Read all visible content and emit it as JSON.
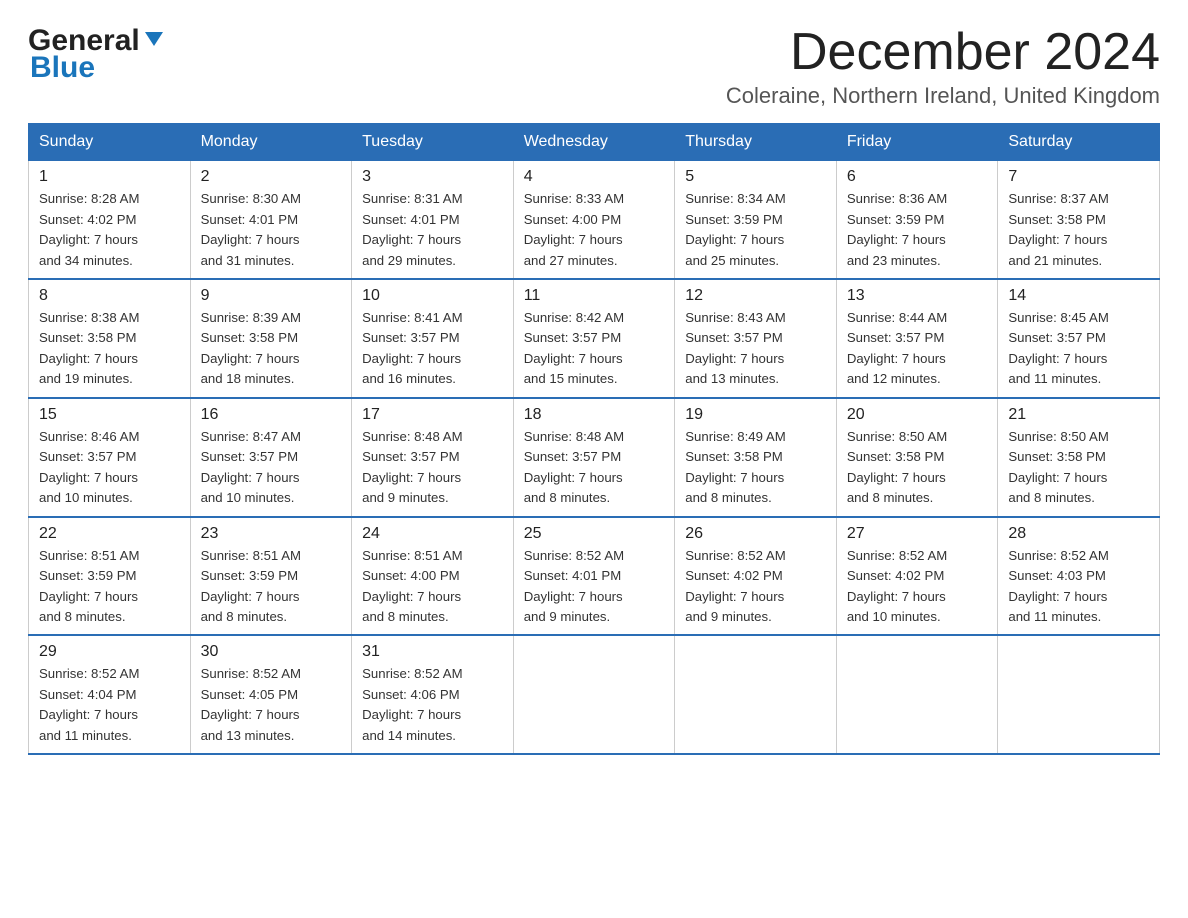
{
  "logo": {
    "general": "General",
    "blue": "Blue"
  },
  "header": {
    "title": "December 2024",
    "subtitle": "Coleraine, Northern Ireland, United Kingdom"
  },
  "days_of_week": [
    "Sunday",
    "Monday",
    "Tuesday",
    "Wednesday",
    "Thursday",
    "Friday",
    "Saturday"
  ],
  "weeks": [
    [
      {
        "day": "1",
        "sunrise": "8:28 AM",
        "sunset": "4:02 PM",
        "daylight": "7 hours and 34 minutes."
      },
      {
        "day": "2",
        "sunrise": "8:30 AM",
        "sunset": "4:01 PM",
        "daylight": "7 hours and 31 minutes."
      },
      {
        "day": "3",
        "sunrise": "8:31 AM",
        "sunset": "4:01 PM",
        "daylight": "7 hours and 29 minutes."
      },
      {
        "day": "4",
        "sunrise": "8:33 AM",
        "sunset": "4:00 PM",
        "daylight": "7 hours and 27 minutes."
      },
      {
        "day": "5",
        "sunrise": "8:34 AM",
        "sunset": "3:59 PM",
        "daylight": "7 hours and 25 minutes."
      },
      {
        "day": "6",
        "sunrise": "8:36 AM",
        "sunset": "3:59 PM",
        "daylight": "7 hours and 23 minutes."
      },
      {
        "day": "7",
        "sunrise": "8:37 AM",
        "sunset": "3:58 PM",
        "daylight": "7 hours and 21 minutes."
      }
    ],
    [
      {
        "day": "8",
        "sunrise": "8:38 AM",
        "sunset": "3:58 PM",
        "daylight": "7 hours and 19 minutes."
      },
      {
        "day": "9",
        "sunrise": "8:39 AM",
        "sunset": "3:58 PM",
        "daylight": "7 hours and 18 minutes."
      },
      {
        "day": "10",
        "sunrise": "8:41 AM",
        "sunset": "3:57 PM",
        "daylight": "7 hours and 16 minutes."
      },
      {
        "day": "11",
        "sunrise": "8:42 AM",
        "sunset": "3:57 PM",
        "daylight": "7 hours and 15 minutes."
      },
      {
        "day": "12",
        "sunrise": "8:43 AM",
        "sunset": "3:57 PM",
        "daylight": "7 hours and 13 minutes."
      },
      {
        "day": "13",
        "sunrise": "8:44 AM",
        "sunset": "3:57 PM",
        "daylight": "7 hours and 12 minutes."
      },
      {
        "day": "14",
        "sunrise": "8:45 AM",
        "sunset": "3:57 PM",
        "daylight": "7 hours and 11 minutes."
      }
    ],
    [
      {
        "day": "15",
        "sunrise": "8:46 AM",
        "sunset": "3:57 PM",
        "daylight": "7 hours and 10 minutes."
      },
      {
        "day": "16",
        "sunrise": "8:47 AM",
        "sunset": "3:57 PM",
        "daylight": "7 hours and 10 minutes."
      },
      {
        "day": "17",
        "sunrise": "8:48 AM",
        "sunset": "3:57 PM",
        "daylight": "7 hours and 9 minutes."
      },
      {
        "day": "18",
        "sunrise": "8:48 AM",
        "sunset": "3:57 PM",
        "daylight": "7 hours and 8 minutes."
      },
      {
        "day": "19",
        "sunrise": "8:49 AM",
        "sunset": "3:58 PM",
        "daylight": "7 hours and 8 minutes."
      },
      {
        "day": "20",
        "sunrise": "8:50 AM",
        "sunset": "3:58 PM",
        "daylight": "7 hours and 8 minutes."
      },
      {
        "day": "21",
        "sunrise": "8:50 AM",
        "sunset": "3:58 PM",
        "daylight": "7 hours and 8 minutes."
      }
    ],
    [
      {
        "day": "22",
        "sunrise": "8:51 AM",
        "sunset": "3:59 PM",
        "daylight": "7 hours and 8 minutes."
      },
      {
        "day": "23",
        "sunrise": "8:51 AM",
        "sunset": "3:59 PM",
        "daylight": "7 hours and 8 minutes."
      },
      {
        "day": "24",
        "sunrise": "8:51 AM",
        "sunset": "4:00 PM",
        "daylight": "7 hours and 8 minutes."
      },
      {
        "day": "25",
        "sunrise": "8:52 AM",
        "sunset": "4:01 PM",
        "daylight": "7 hours and 9 minutes."
      },
      {
        "day": "26",
        "sunrise": "8:52 AM",
        "sunset": "4:02 PM",
        "daylight": "7 hours and 9 minutes."
      },
      {
        "day": "27",
        "sunrise": "8:52 AM",
        "sunset": "4:02 PM",
        "daylight": "7 hours and 10 minutes."
      },
      {
        "day": "28",
        "sunrise": "8:52 AM",
        "sunset": "4:03 PM",
        "daylight": "7 hours and 11 minutes."
      }
    ],
    [
      {
        "day": "29",
        "sunrise": "8:52 AM",
        "sunset": "4:04 PM",
        "daylight": "7 hours and 11 minutes."
      },
      {
        "day": "30",
        "sunrise": "8:52 AM",
        "sunset": "4:05 PM",
        "daylight": "7 hours and 13 minutes."
      },
      {
        "day": "31",
        "sunrise": "8:52 AM",
        "sunset": "4:06 PM",
        "daylight": "7 hours and 14 minutes."
      },
      null,
      null,
      null,
      null
    ]
  ],
  "labels": {
    "sunrise": "Sunrise:",
    "sunset": "Sunset:",
    "daylight": "Daylight:"
  }
}
